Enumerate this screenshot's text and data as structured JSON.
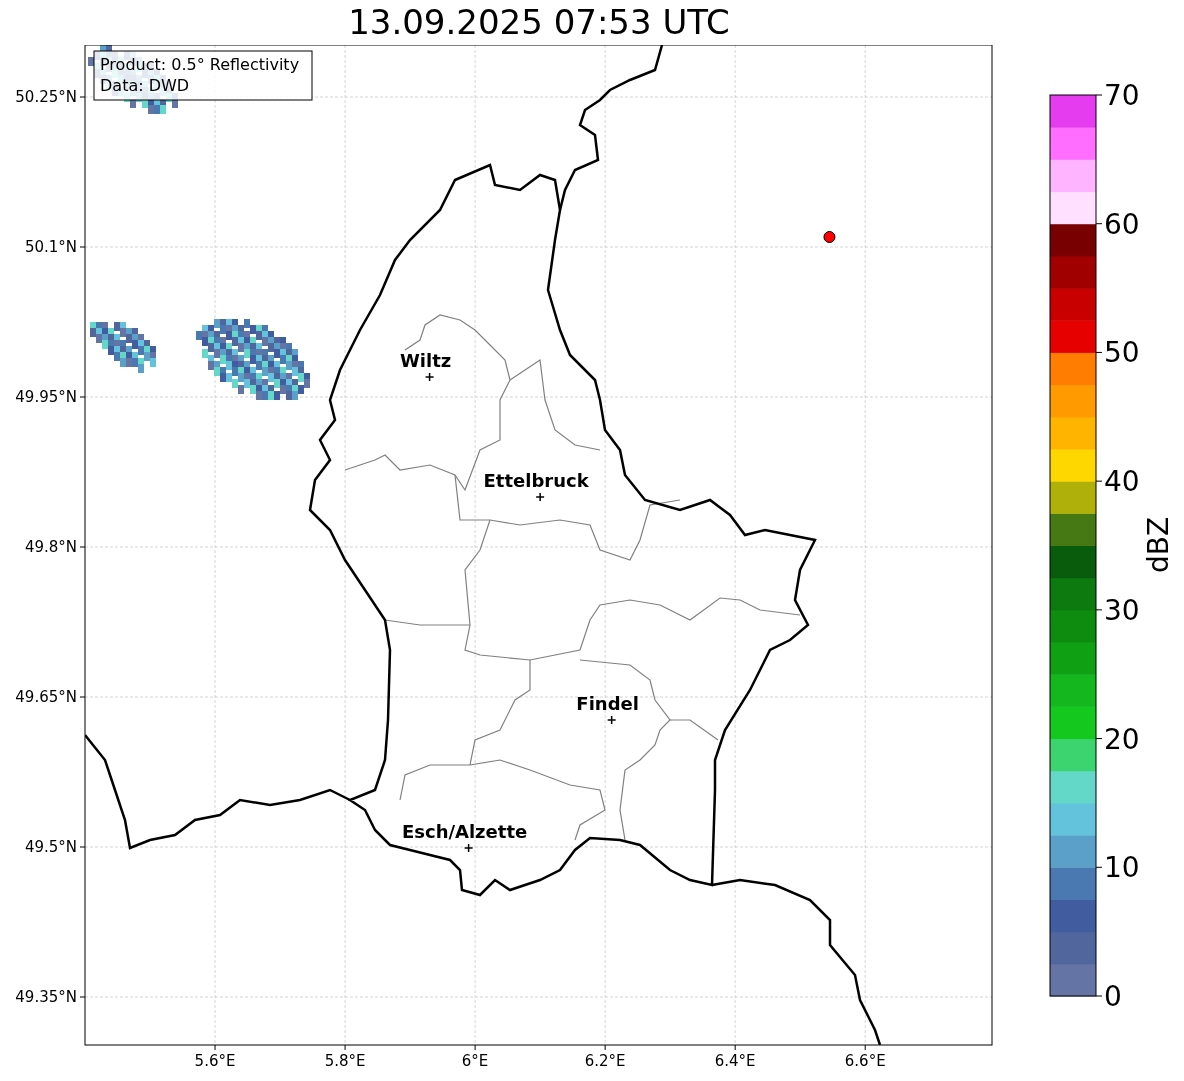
{
  "figure": {
    "info_box": [
      "Product: 0.5° Reflectivity",
      "Data: DWD"
    ],
    "chart_data": {
      "type": "scatter",
      "title": "13.09.2025 07:53 UTC",
      "grid": true,
      "xlim": [
        5.4,
        6.795
      ],
      "ylim": [
        49.302,
        50.302
      ],
      "xticks": [
        {
          "value": 5.6,
          "label": "5.6°E"
        },
        {
          "value": 5.8,
          "label": "5.8°E"
        },
        {
          "value": 6.0,
          "label": "6°E"
        },
        {
          "value": 6.2,
          "label": "6.2°E"
        },
        {
          "value": 6.4,
          "label": "6.4°E"
        },
        {
          "value": 6.6,
          "label": "6.6°E"
        }
      ],
      "yticks": [
        {
          "value": 50.25,
          "label": "50.25°N"
        },
        {
          "value": 50.1,
          "label": "50.1°N"
        },
        {
          "value": 49.95,
          "label": "49.95°N"
        },
        {
          "value": 49.8,
          "label": "49.8°N"
        },
        {
          "value": 49.65,
          "label": "49.65°N"
        },
        {
          "value": 49.5,
          "label": "49.5°N"
        },
        {
          "value": 49.35,
          "label": "49.35°N"
        }
      ],
      "series": [
        {
          "color": "#000000",
          "x": [
            5.93,
            6.1,
            6.21,
            5.99
          ],
          "values": [
            49.97,
            49.85,
            49.627,
            49.499
          ]
        },
        {
          "color": "#ff0000",
          "x": [
            6.545
          ],
          "values": [
            50.11
          ]
        }
      ],
      "annotations": [
        {
          "text": "Wiltz",
          "x": 5.93,
          "y": 49.97
        },
        {
          "text": "Ettelbruck",
          "x": 6.1,
          "y": 49.85
        },
        {
          "text": "Findel",
          "x": 6.21,
          "y": 49.627
        },
        {
          "text": "Esch/Alzette",
          "x": 5.99,
          "y": 49.499
        }
      ]
    }
  },
  "colorbar": {
    "label": "dBZ",
    "ticks": [
      "70",
      "60",
      "50",
      "40",
      "30",
      "20",
      "10",
      "0"
    ]
  }
}
